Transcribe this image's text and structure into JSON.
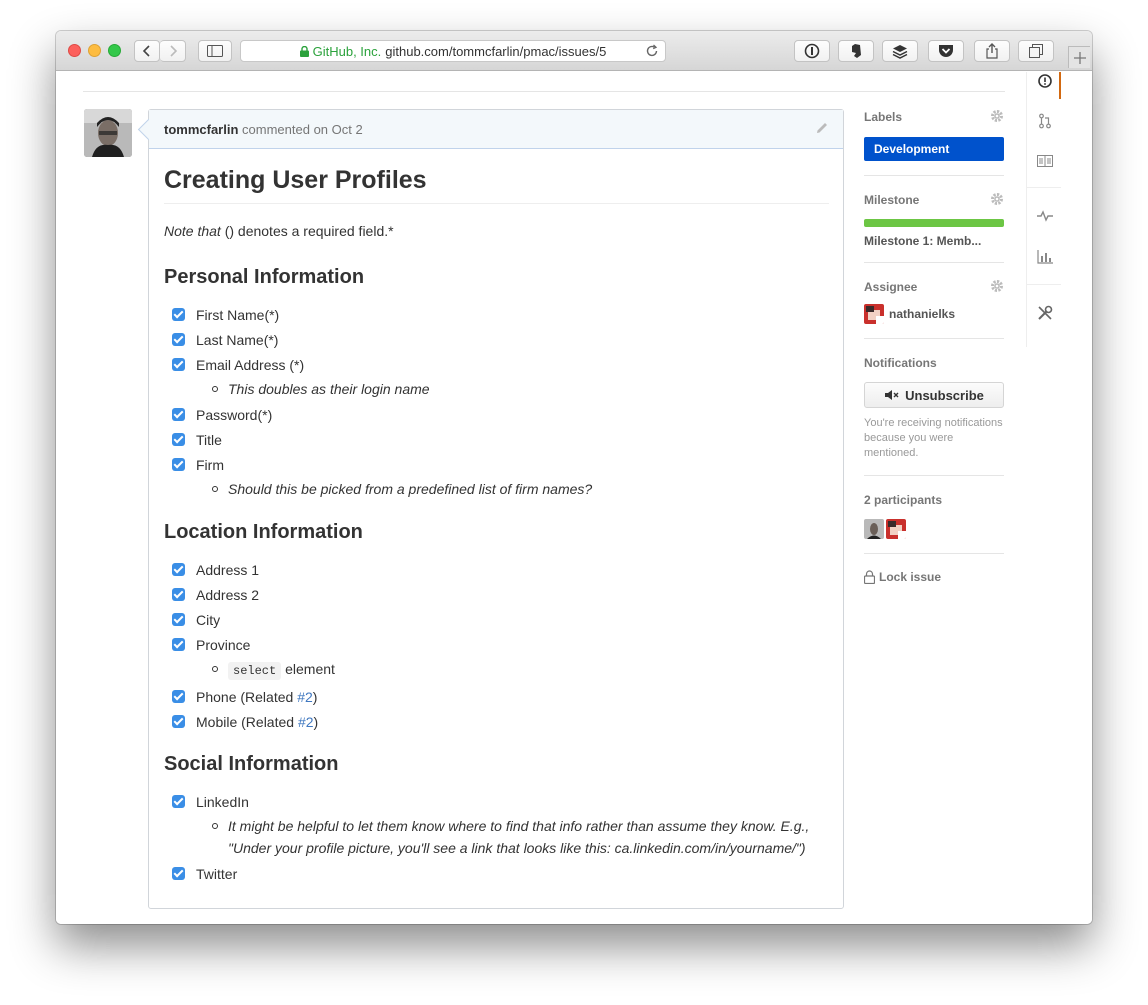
{
  "browser": {
    "org": "GitHub, Inc.",
    "url": "github.com/tommcfarlin/pmac/issues/5"
  },
  "comment": {
    "author": "tommcfarlin",
    "action": "commented on Oct 2",
    "title": "Creating User Profiles",
    "note_italic": "Note that ",
    "note_rest": "() denotes a required field.*",
    "sections": {
      "personal": {
        "heading": "Personal Information",
        "items": [
          "First Name(*)",
          "Last Name(*)",
          "Email Address (*)",
          "This doubles as their login name",
          "Password(*)",
          "Title",
          "Firm",
          "Should this be picked from a predefined list of firm names?"
        ]
      },
      "location": {
        "heading": "Location Information",
        "items": [
          "Address 1",
          "Address 2",
          "City",
          "Province",
          "select",
          "element",
          "Phone (Related ",
          "#2",
          ")",
          "Mobile (Related ",
          "#2",
          ")"
        ]
      },
      "social": {
        "heading": "Social Information",
        "items": [
          "LinkedIn",
          "It might be helpful to let them know where to find that info rather than assume they know. E.g., \"Under your profile picture, you'll see a link that looks like this: ca.linkedin.com/in/yourname/\")",
          "Twitter"
        ]
      }
    }
  },
  "sidebar": {
    "labels": {
      "title": "Labels",
      "value": "Development",
      "color": "#0052cc"
    },
    "milestone": {
      "title": "Milestone",
      "name": "Milestone 1: Memb...",
      "progress": 1.0,
      "color": "#6cc644"
    },
    "assignee": {
      "title": "Assignee",
      "name": "nathanielks"
    },
    "notifications": {
      "title": "Notifications",
      "button": "Unsubscribe",
      "text": "You're receiving notifications because you were mentioned."
    },
    "participants": {
      "title": "2 participants"
    },
    "lock": {
      "label": "Lock issue"
    }
  },
  "icons": {
    "repnav": [
      "issue-opened-icon",
      "pull-request-icon",
      "wiki-book-icon",
      "pulse-icon",
      "graph-icon",
      "settings-tools-icon"
    ]
  }
}
